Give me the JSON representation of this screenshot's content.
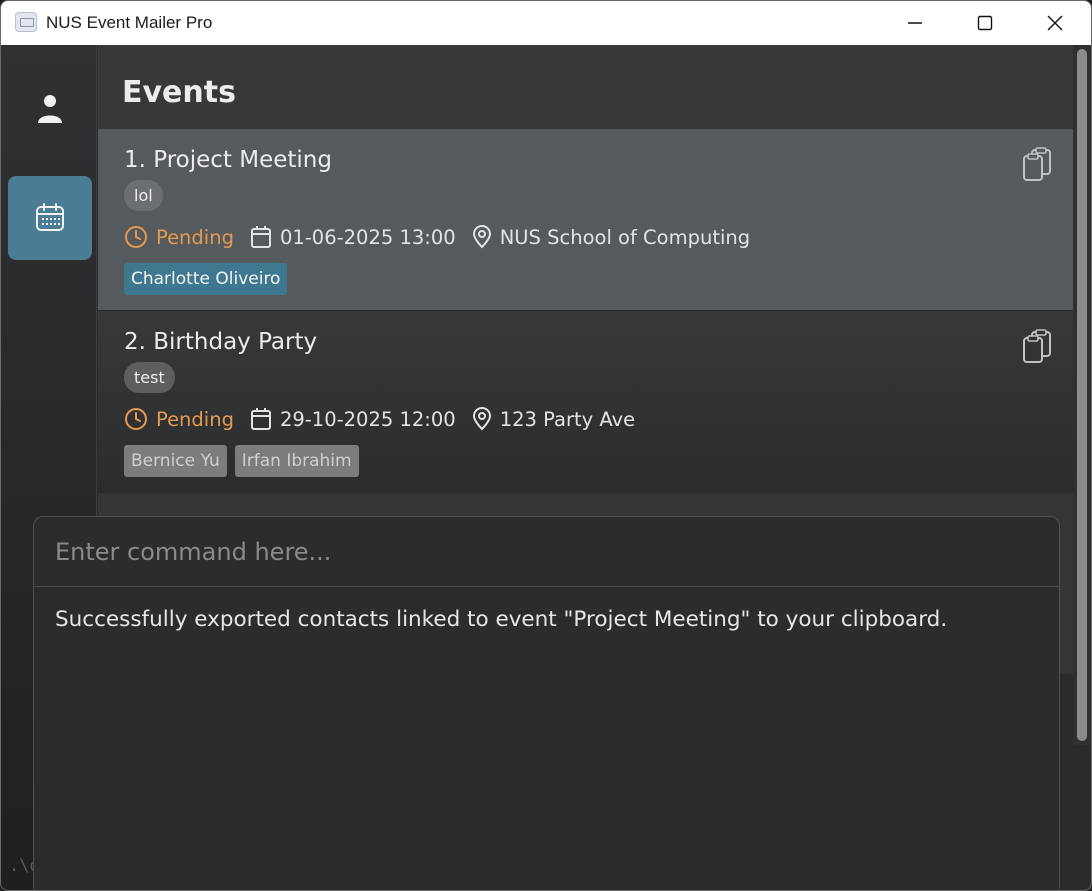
{
  "window": {
    "title": "NUS Event Mailer Pro"
  },
  "sidebar": {
    "items": [
      {
        "icon": "person-icon"
      },
      {
        "icon": "calendar-icon",
        "active": true
      }
    ]
  },
  "page": {
    "title": "Events"
  },
  "events": [
    {
      "name": "1. Project Meeting",
      "tag": "lol",
      "status": "Pending",
      "datetime": "01-06-2025 13:00",
      "location": "NUS School of Computing",
      "contacts": [
        "Charlotte Oliveiro"
      ]
    },
    {
      "name": "2. Birthday Party",
      "tag": "test",
      "status": "Pending",
      "datetime": "29-10-2025 12:00",
      "location": "123 Party Ave",
      "contacts": [
        "Bernice Yu",
        "Irfan Ibrahim"
      ]
    }
  ],
  "command": {
    "placeholder": "Enter command here...",
    "value": ""
  },
  "result": {
    "message": "Successfully exported contacts linked to event \"Project Meeting\" to your clipboard."
  },
  "footer": {
    "path": ".\\d"
  },
  "colors": {
    "accent": "#4a7d93",
    "pending": "#e59a4f",
    "selected_card": "#555a5e",
    "linked_chip": "#3e7890"
  }
}
